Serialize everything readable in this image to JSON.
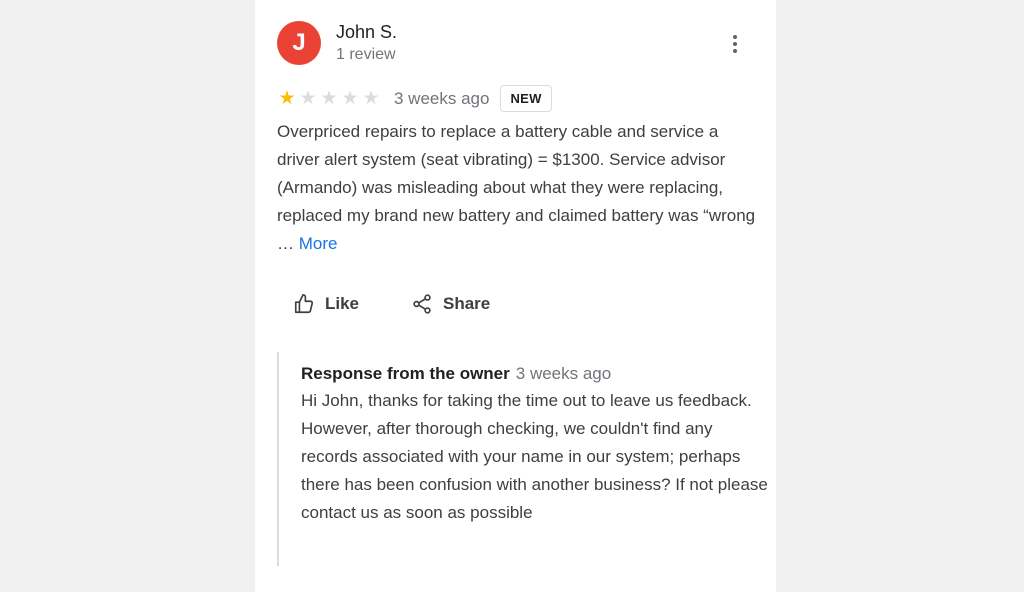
{
  "review": {
    "avatar_letter": "J",
    "avatar_color": "#ea4335",
    "reviewer_name": "John S.",
    "reviewer_meta": "1 review",
    "rating": 1,
    "max_rating": 5,
    "star_filled_color": "#fbbc04",
    "star_empty_color": "#dadce0",
    "time": "3 weeks ago",
    "badge": "NEW",
    "text": "Overpriced repairs to replace a battery cable and service a driver alert system (seat vibrating) = $1300. Service advisor (Armando) was misleading about what they were replacing, replaced my brand new battery and claimed battery was “wrong …",
    "more_label": "More"
  },
  "actions": {
    "like_label": "Like",
    "share_label": "Share"
  },
  "owner_response": {
    "title": "Response from the owner",
    "time": "3 weeks ago",
    "text": "Hi John, thanks for taking the time out to leave us feedback. However, after thorough checking, we couldn't find any records associated with your name in our system; perhaps there has been confusion with another business? If not please contact us as soon as possible"
  }
}
